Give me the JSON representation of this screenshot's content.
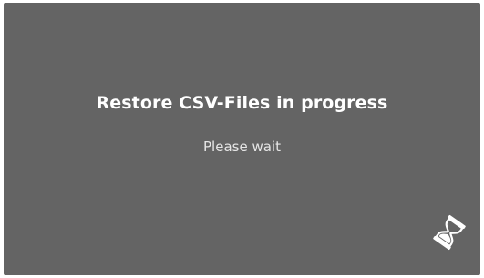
{
  "dialog": {
    "title": "Restore CSV-Files in progress",
    "subtitle": "Please wait",
    "icon": "hourglass-icon",
    "background_color": "#646464",
    "text_color": "#ffffff"
  }
}
